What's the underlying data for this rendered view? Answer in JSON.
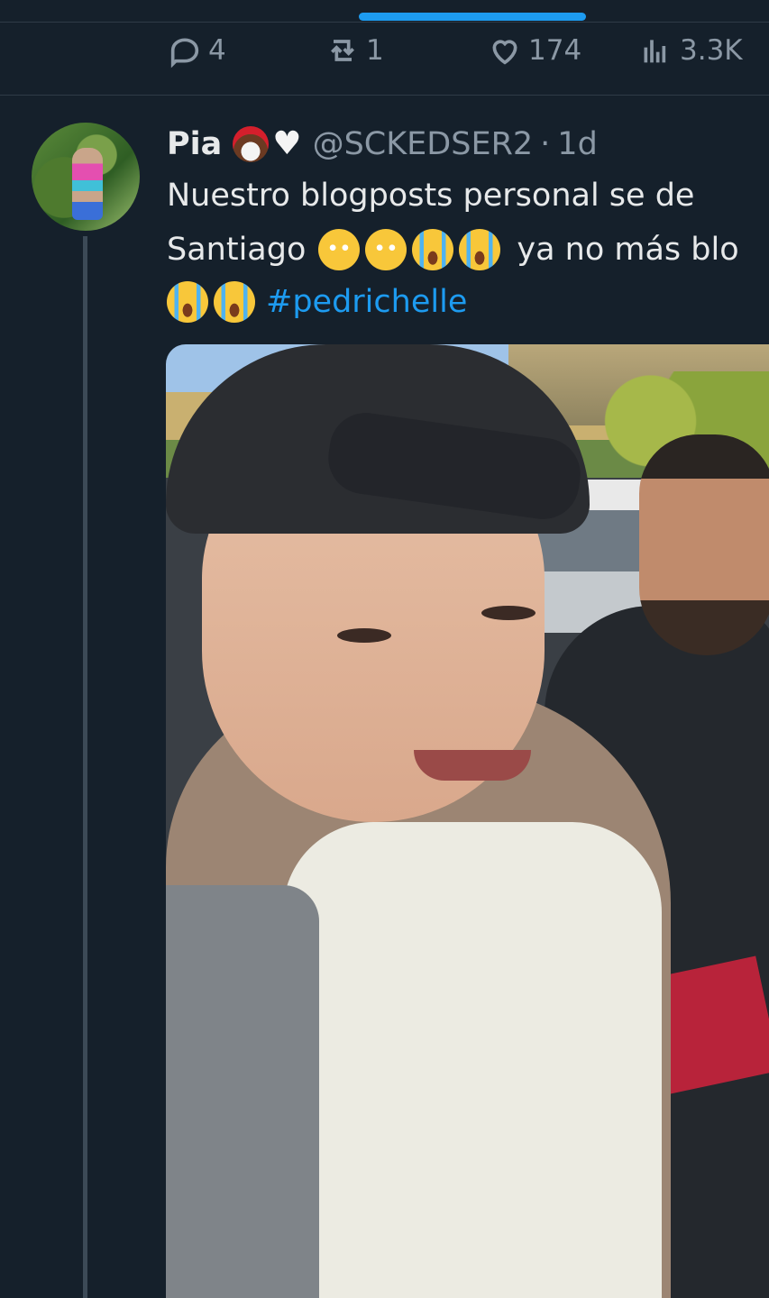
{
  "top_actions": {
    "replies": "4",
    "retweets": "1",
    "likes": "174",
    "views": "3.3K"
  },
  "tweet": {
    "author_name": "Pia",
    "handle": "@SCKEDSER2",
    "separator": "·",
    "time": "1d",
    "line1": "Nuestro blogposts personal se de",
    "line2_start": "Santiago",
    "line2_end": "ya no más blo",
    "hashtag": "#pedrichelle"
  },
  "icons": {
    "reply": "reply-icon",
    "retweet": "retweet-icon",
    "like": "heart-icon",
    "views": "views-icon",
    "badge_emoji_1": "santa-emoji",
    "badge_emoji_2": "white-heart-emoji",
    "emoji_pleading": "pleading-face-emoji",
    "emoji_crying": "loudly-crying-face-emoji"
  },
  "colors": {
    "background": "#15202b",
    "accent": "#1d9bf0",
    "secondary_text": "#8b98a5",
    "primary_text": "#e7e9ea"
  }
}
